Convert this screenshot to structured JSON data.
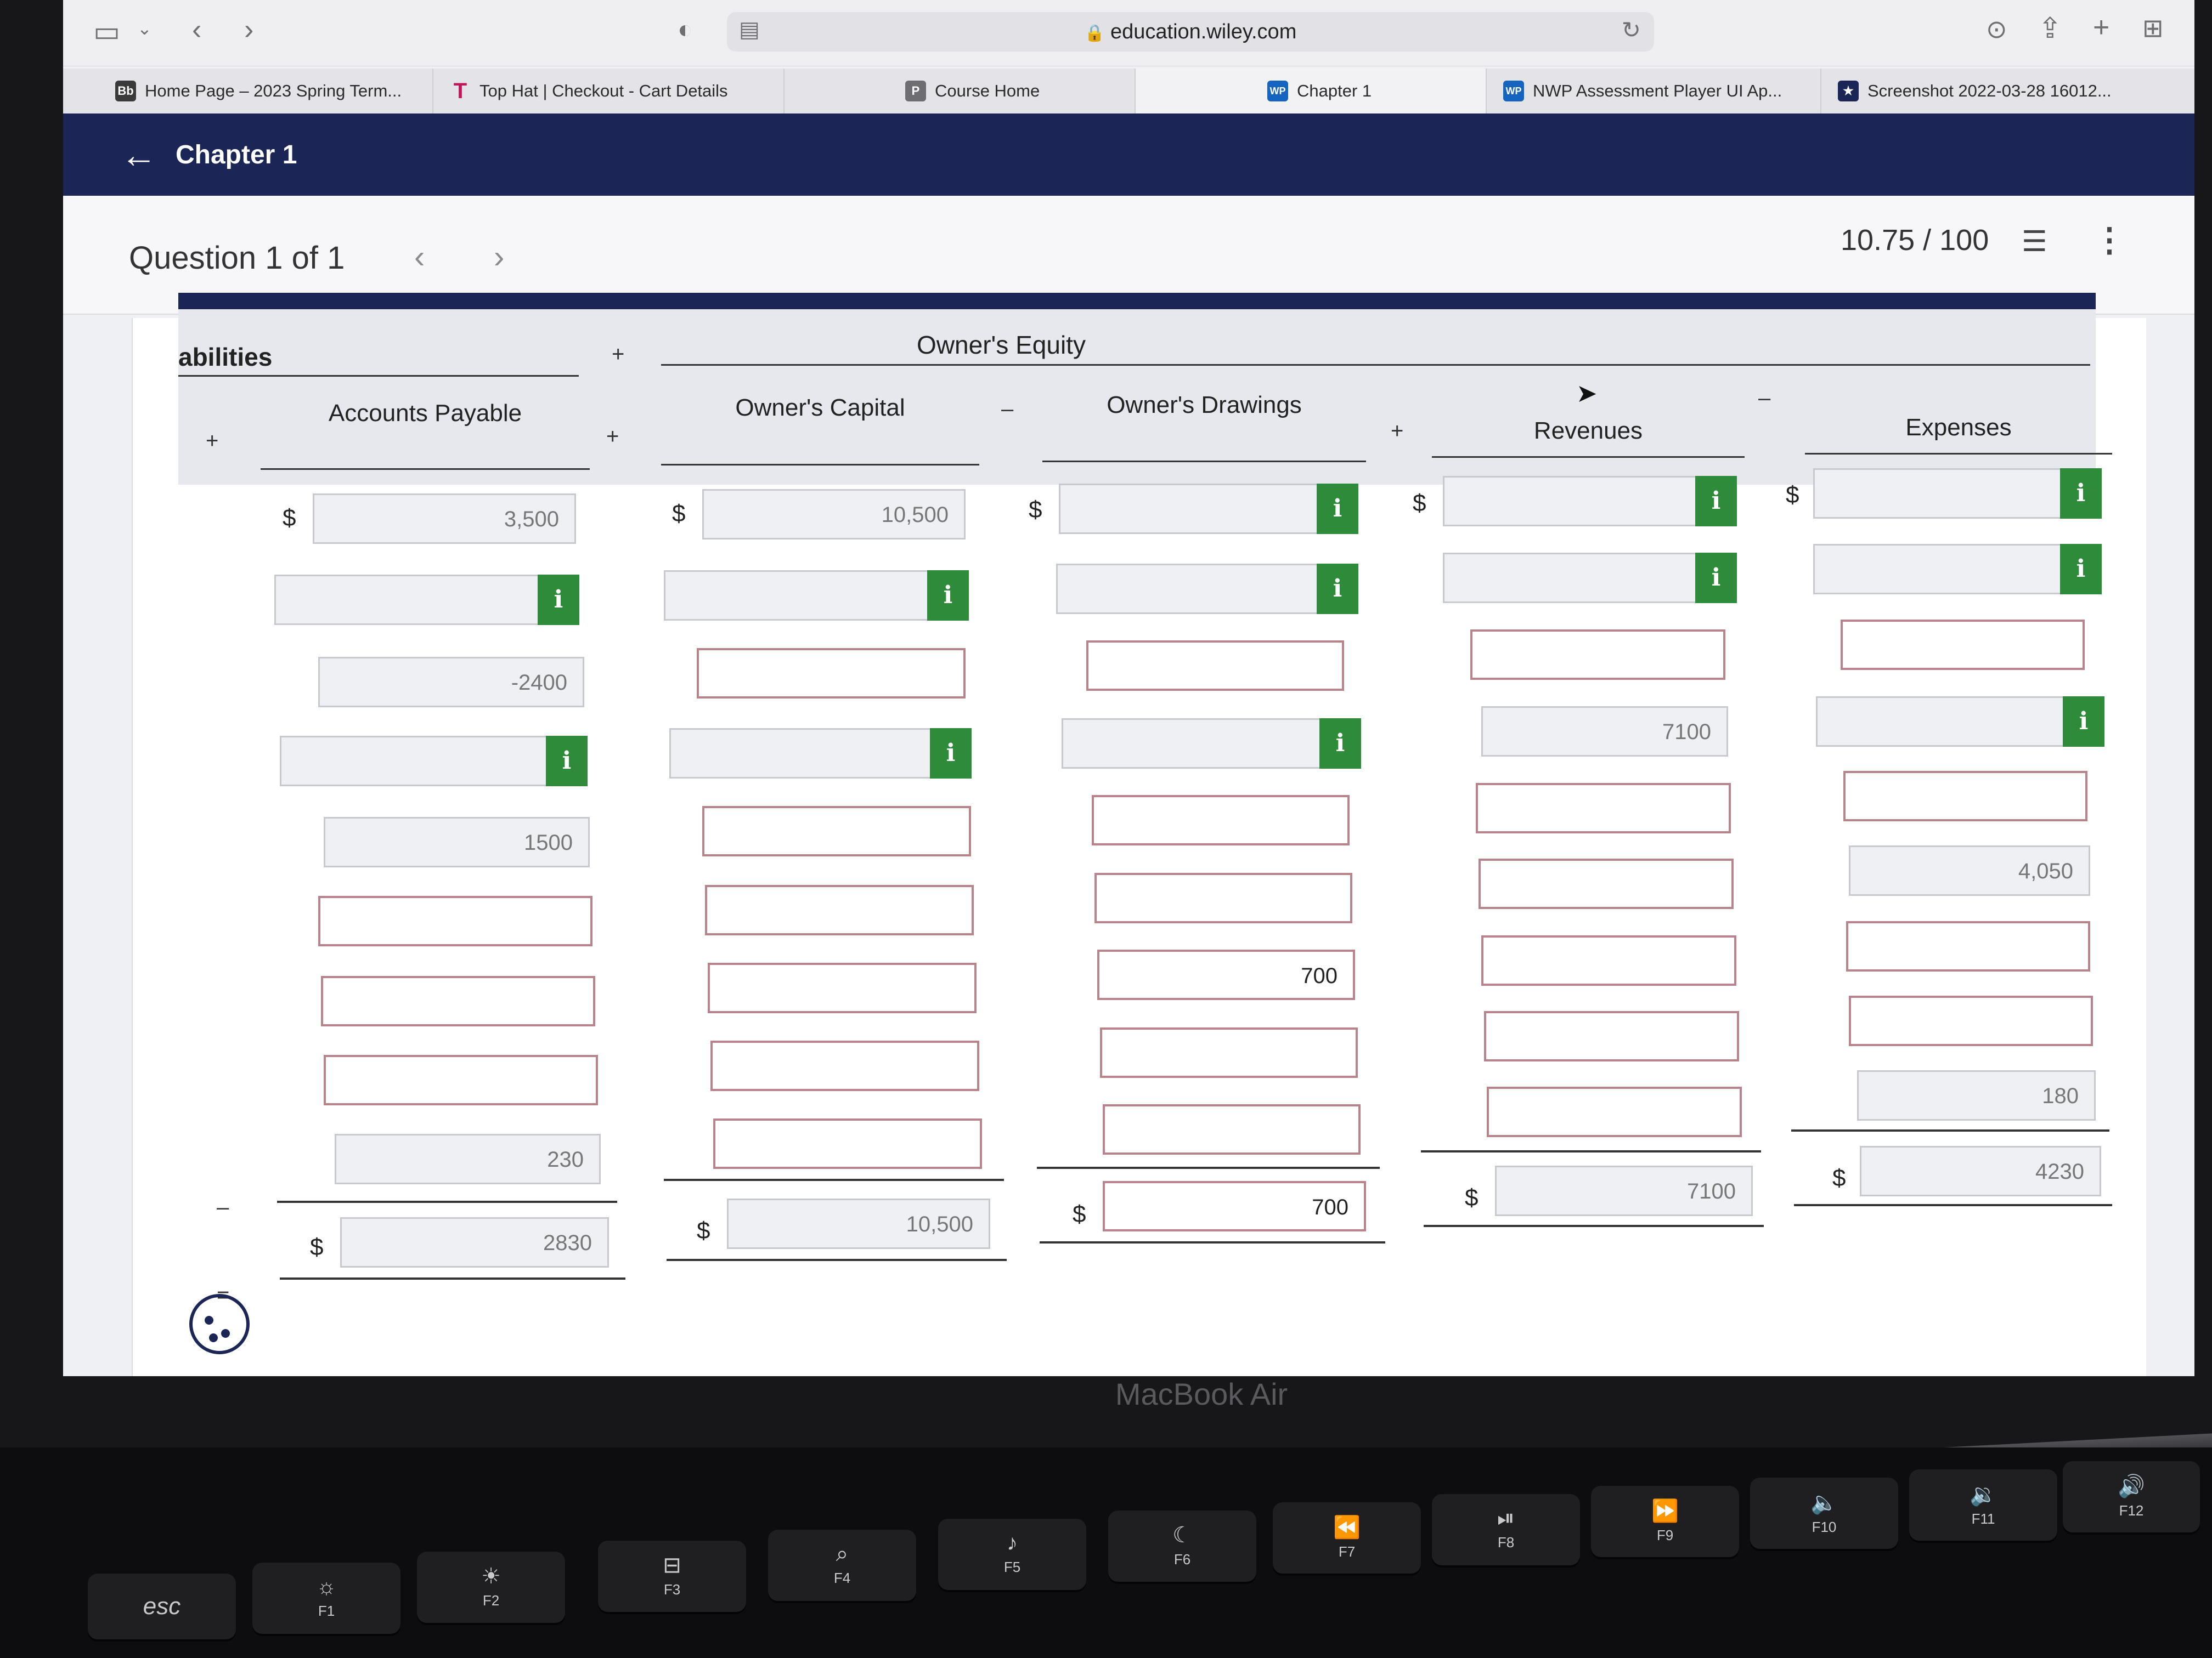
{
  "browser": {
    "url": "education.wiley.com",
    "tabs": [
      {
        "label": "Home Page – 2023 Spring Term...",
        "favicon": "Bb",
        "color": "#3a3a3a"
      },
      {
        "label": "Top Hat | Checkout - Cart Details",
        "favicon": "T",
        "color": "#c2185b"
      },
      {
        "label": "Course Home",
        "favicon": "P",
        "color": "#6d6d72"
      },
      {
        "label": "Chapter 1",
        "favicon": "WP",
        "color": "#1565c0"
      },
      {
        "label": "NWP Assessment Player UI Ap...",
        "favicon": "WP",
        "color": "#1565c0"
      },
      {
        "label": "Screenshot 2022-03-28 16012...",
        "favicon": "★",
        "color": "#1b2657"
      }
    ]
  },
  "app": {
    "chapter_title": "Chapter 1",
    "question_label": "Question 1 of 1",
    "score": "10.75 / 100"
  },
  "table": {
    "liabilities_label": "abilities",
    "owners_equity_label": "Owner's Equity",
    "columns": {
      "accounts_payable": "Accounts Payable",
      "owners_capital": "Owner's Capital",
      "owners_drawings": "Owner's Drawings",
      "revenues": "Revenues",
      "expenses": "Expenses"
    },
    "signs": {
      "plus": "+",
      "minus": "–",
      "equals": "="
    },
    "currency": "$",
    "accounts_payable": {
      "r1": "3,500",
      "r3": "-2400",
      "r5": "1500",
      "r9": "230",
      "total": "2830"
    },
    "owners_capital": {
      "r1": "10,500",
      "total": "10,500"
    },
    "owners_drawings": {
      "r7": "700",
      "total": "700"
    },
    "revenues": {
      "r4": "7100",
      "total": "7100"
    },
    "expenses": {
      "r6": "4,050",
      "r8": "180",
      "total": "4230"
    }
  },
  "laptop": {
    "model_label": "MacBook Air",
    "keys": {
      "esc": "esc",
      "f1": "F1",
      "f2": "F2",
      "f3": "F3",
      "f4": "F4",
      "f5": "F5",
      "f6": "F6",
      "f7": "F7",
      "f8": "F8",
      "f9": "F9",
      "f10": "F10",
      "f11": "F11",
      "f12": "F12"
    }
  }
}
